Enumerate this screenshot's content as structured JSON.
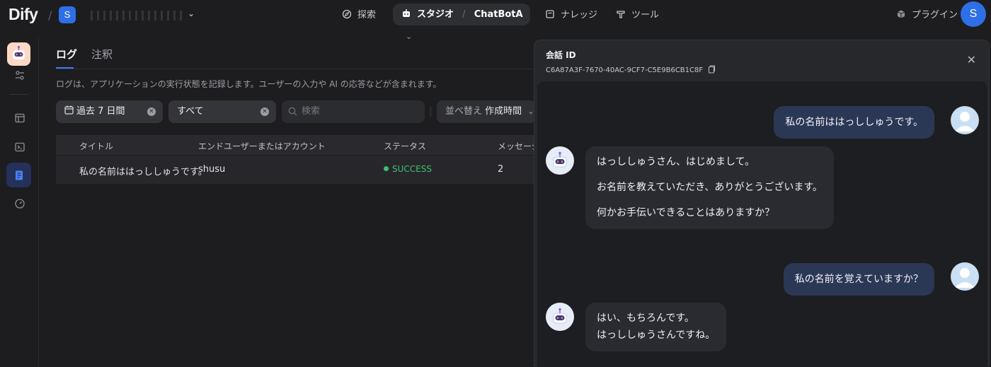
{
  "header": {
    "logo": "Dify",
    "workspace_badge": "S",
    "nav": {
      "explore": "探索",
      "studio": "スタジオ",
      "app_name": "ChatBotA",
      "knowledge": "ナレッジ",
      "tools": "ツール",
      "plugins": "プラグイン"
    },
    "user_avatar": "S"
  },
  "tabs": {
    "log": "ログ",
    "annotation": "注釈"
  },
  "description": "ログは、アプリケーションの実行状態を記録します。ユーザーの入力や AI の応答などが含まれます。",
  "filters": {
    "period": "過去 7 日間",
    "status": "すべて",
    "search_placeholder": "検索",
    "sort_label": "並べ替え",
    "sort_value": "作成時間"
  },
  "table": {
    "headers": [
      "タイトル",
      "エンドユーザーまたはアカウント",
      "ステータス",
      "メッセージ数"
    ],
    "rows": [
      {
        "title": "私の名前ははっししゅうです。",
        "user": "shusu",
        "status": "SUCCESS",
        "messages": "2"
      }
    ]
  },
  "conversation": {
    "label": "会話 ID",
    "id": "C6A87A3F-7670-40AC-9CF7-C5E9B6CB1C8F",
    "messages": [
      {
        "role": "user",
        "text": "私の名前ははっししゅうです。"
      },
      {
        "role": "bot",
        "lines": [
          "はっししゅうさん、はじめまして。",
          "お名前を教えていただき、ありがとうございます。",
          "何かお手伝いできることはありますか？"
        ]
      },
      {
        "role": "user",
        "text": "私の名前を覚えていますか？"
      },
      {
        "role": "bot",
        "lines": [
          "はい、もちろんです。",
          "はっししゅうさんですね。"
        ]
      }
    ]
  },
  "colors": {
    "accent": "#2e6fe8",
    "success": "#3fbf72",
    "user_bubble": "#2b3855"
  }
}
